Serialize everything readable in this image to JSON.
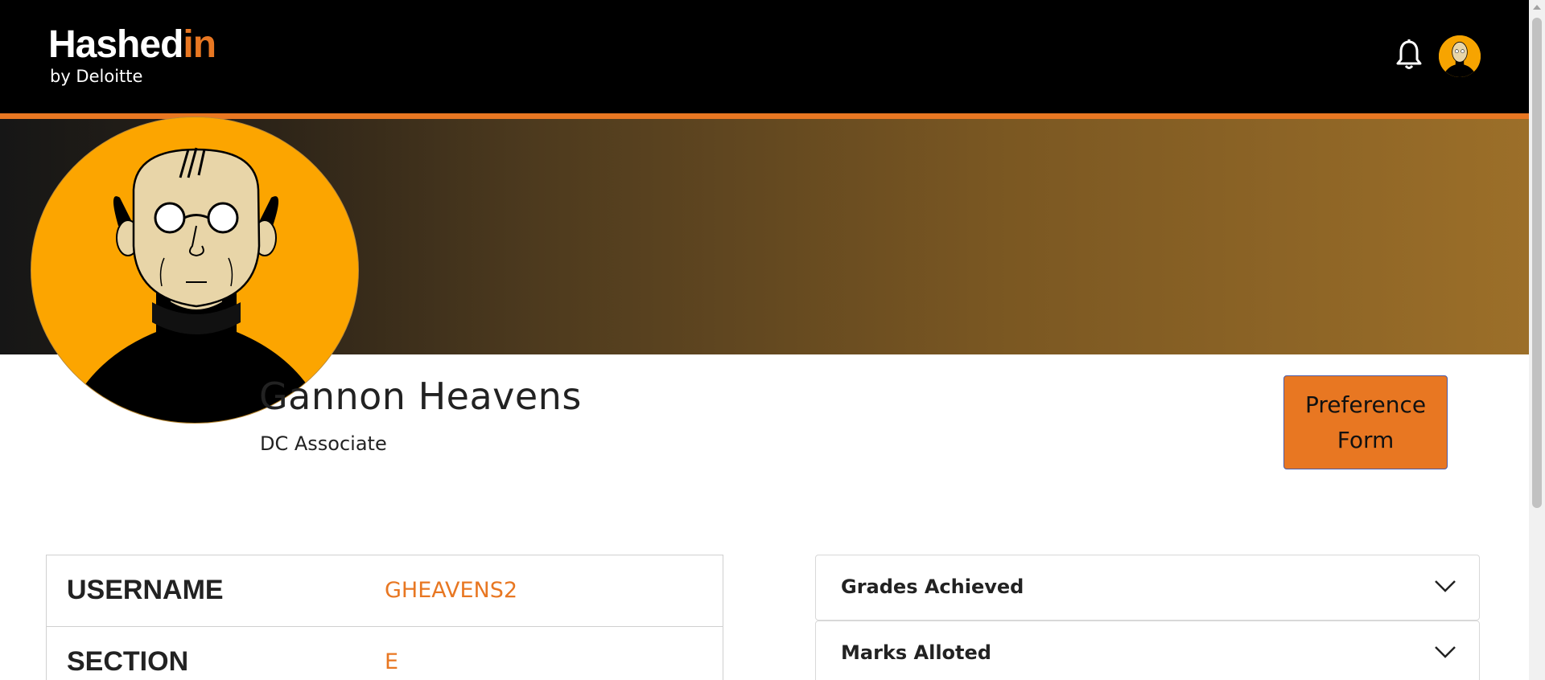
{
  "header": {
    "logo_main": "Hashed",
    "logo_accent": "in",
    "logo_sub": "by Deloitte",
    "icons": [
      "bell-icon",
      "user-avatar"
    ]
  },
  "profile": {
    "name": "Gannon Heavens",
    "role": "DC Associate",
    "preference_button": "Preference Form"
  },
  "info_table": [
    {
      "label": "USERNAME",
      "value": "GHEAVENS2"
    },
    {
      "label": "SECTION",
      "value": "E"
    }
  ],
  "accordion": [
    {
      "label": "Grades Achieved"
    },
    {
      "label": "Marks Alloted"
    }
  ],
  "colors": {
    "brand_orange": "#e87722",
    "avatar_bg": "#fca500",
    "topbar": "#000000"
  }
}
